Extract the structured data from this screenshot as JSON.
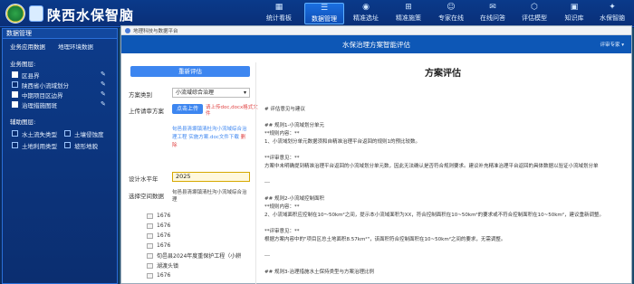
{
  "app": {
    "title": "陕西水保智脑"
  },
  "nav": [
    {
      "label": "统计看板",
      "icon": "chart-icon"
    },
    {
      "label": "数据管理",
      "icon": "database-icon",
      "active": true
    },
    {
      "label": "精准选址",
      "icon": "location-icon"
    },
    {
      "label": "精准施策",
      "icon": "strategy-icon"
    },
    {
      "label": "专家在线",
      "icon": "expert-icon"
    },
    {
      "label": "在线问答",
      "icon": "chat-icon"
    },
    {
      "label": "评估模型",
      "icon": "model-icon"
    },
    {
      "label": "知识库",
      "icon": "book-icon"
    },
    {
      "label": "水保智脑",
      "icon": "brain-icon"
    }
  ],
  "sidebar": {
    "header": "数据管理",
    "tabs": [
      "业务应用数据",
      "地理环境数据"
    ],
    "business_layers_title": "业务图层:",
    "business_layers": [
      "区县界",
      "陕西省小流域划分",
      "中期项目区边界",
      "治理措施图斑"
    ],
    "aux_layers_title": "辅助图层:",
    "aux_layers": [
      [
        "水土流失类型",
        "土壤侵蚀度"
      ],
      [
        "土地利用类型",
        "坡形地貌"
      ]
    ]
  },
  "window": {
    "tab_title": "地理科技与数据平台",
    "header_title": "水保治理方案智能评估",
    "user_label": "评审专家"
  },
  "form": {
    "reeval_button": "重新评估",
    "plan_type_label": "方案类别",
    "plan_type_value": "小流域综合治理",
    "upload_label": "上传请审方案",
    "upload_button": "点击上传",
    "upload_hint": "请上传doc,docx格式文件",
    "file_name": "旬邑县清塬镇清杜沟小流域综合治理工程 实施方案.doc文件下载",
    "file_delete": "删除",
    "year_label": "设计水平年",
    "year_value": "2025",
    "scope_label": "选择空间数据",
    "scope_value": "旬邑县清塬镇清杜沟小流域综合治理",
    "tree": [
      "1676",
      "1676",
      "1676",
      "1676",
      "旬邑县2024年度重保护工程（小耕",
      "湖渡头镇",
      "1676"
    ]
  },
  "result": {
    "title": "方案评估",
    "lines": [
      "# 评估意见与建议",
      "",
      "## 规则1-小流域划分单元",
      "**规则内容：**",
      "1、小流域划分单元数据须和自精准治理平台返回的规则1的预比较数。",
      "",
      "**评审意见：**",
      "方案中未明确提到精准治理平台返回的小流域划分单元数，因此无法确认是否符合规则要求。建议补充精准治理平台返回的具体数据以验证小流域划分单",
      "",
      "---",
      "",
      "## 规则2-小流域控制面积",
      "**规则内容：**",
      "2、小流域面积应控制在10～50km²之间，提示本小流域面积为XX，符合控制面积在10~50km²的要求或不符合控制面积在10~50km²，建议重新调整。",
      "",
      "**评审意见：**",
      "根据方案内容中的\"项目区总土地面积8.57km²\"，该面积符合控制面积在10~50km²之间的要求，无需调整。",
      "",
      "---",
      "",
      "## 规则3-治理措施水土保持类型与方案治理比例"
    ]
  }
}
